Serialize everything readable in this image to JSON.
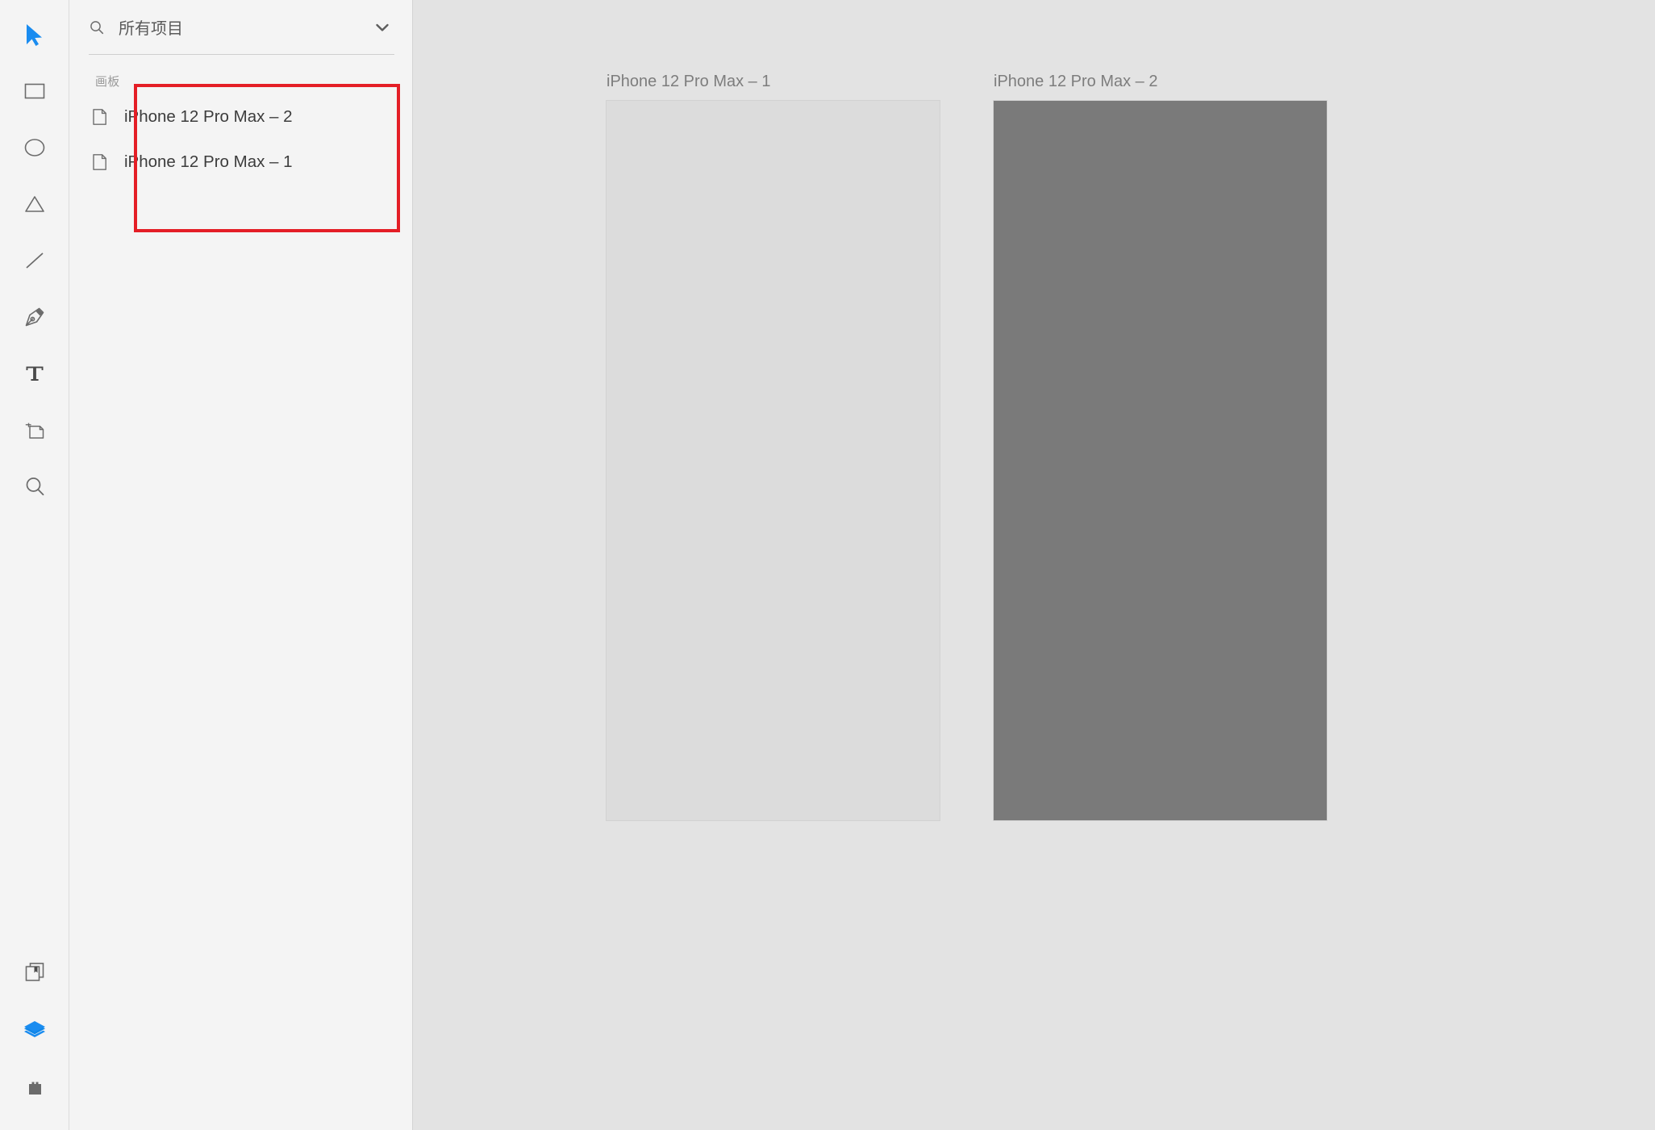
{
  "toolbar": {
    "tools": [
      {
        "name": "select-tool",
        "icon": "cursor-arrow-icon",
        "label": "Select",
        "active": true
      },
      {
        "name": "rectangle-tool",
        "icon": "rectangle-icon",
        "label": "Rectangle",
        "active": false
      },
      {
        "name": "oval-tool",
        "icon": "oval-icon",
        "label": "Oval",
        "active": false
      },
      {
        "name": "triangle-tool",
        "icon": "triangle-icon",
        "label": "Triangle",
        "active": false
      },
      {
        "name": "line-tool",
        "icon": "line-icon",
        "label": "Line",
        "active": false
      },
      {
        "name": "vector-pen-tool",
        "icon": "pen-nib-icon",
        "label": "Vector",
        "active": false
      },
      {
        "name": "text-tool",
        "icon": "text-t-icon",
        "label": "Text",
        "active": false
      },
      {
        "name": "artboard-tool",
        "icon": "artboard-icon",
        "label": "Artboard",
        "active": false
      },
      {
        "name": "zoom-tool",
        "icon": "magnifier-icon",
        "label": "Zoom",
        "active": false
      }
    ],
    "bottom_tools": [
      {
        "name": "assets-panel-button",
        "icon": "pages-bookmark-icon",
        "label": "Assets",
        "active": false
      },
      {
        "name": "layers-panel-button",
        "icon": "layers-stack-icon",
        "label": "Layers",
        "active": true
      },
      {
        "name": "plugins-panel-button",
        "icon": "plugin-block-icon",
        "label": "Plugins",
        "active": false
      }
    ]
  },
  "search": {
    "value": "所有项目",
    "placeholder": "所有项目",
    "icon": "search-icon",
    "dropdown_icon": "chevron-down-icon"
  },
  "layers": {
    "group_label": "画板",
    "items": [
      {
        "label": "iPhone 12 Pro Max – 2",
        "icon": "artboard-page-icon"
      },
      {
        "label": "iPhone 12 Pro Max – 1",
        "icon": "artboard-page-icon"
      }
    ]
  },
  "canvas": {
    "artboards": [
      {
        "label": "iPhone 12 Pro Max – 1",
        "fill": "#dcdcdc"
      },
      {
        "label": "iPhone 12 Pro Max – 2",
        "fill": "#7a7a7a"
      }
    ],
    "background": "#e3e3e3"
  },
  "annotation": {
    "color": "#e41e26",
    "target": "artboards-group-in-layer-list"
  }
}
